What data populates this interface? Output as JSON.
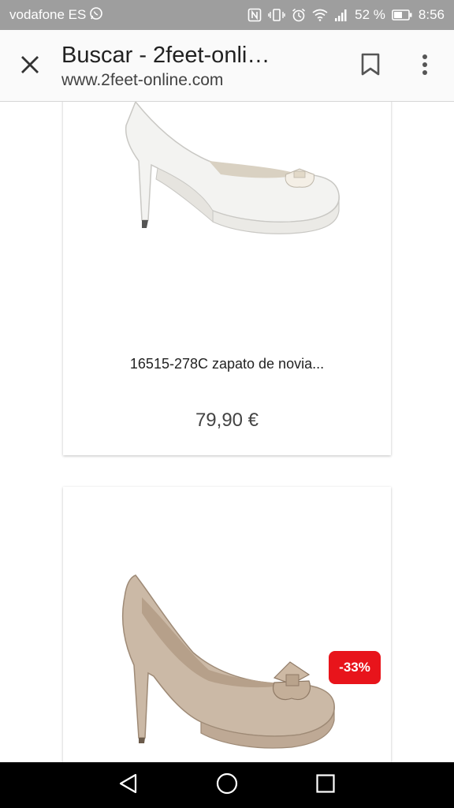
{
  "status_bar": {
    "carrier": "vodafone ES",
    "battery_percent": "52 %",
    "time": "8:56"
  },
  "toolbar": {
    "title": "Buscar - 2feet-onli…",
    "url": "www.2feet-online.com"
  },
  "products": [
    {
      "name": "16515-278C zapato de novia...",
      "price": "79,90 €"
    },
    {
      "discount": "-33%"
    }
  ],
  "colors": {
    "status_bar": "#9e9e9e",
    "toolbar": "#fafafa",
    "discount_badge": "#e8141b",
    "nav_bar": "#000000"
  }
}
